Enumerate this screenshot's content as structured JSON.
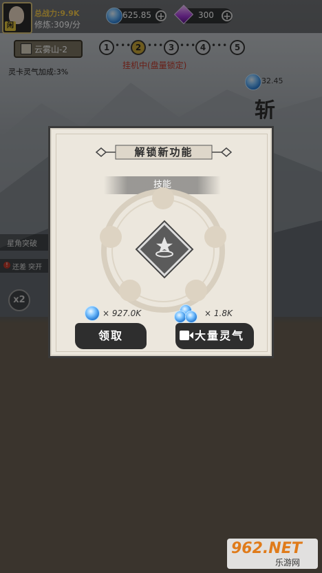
{
  "topbar": {
    "combat_label": "总战力:",
    "combat_value": "9.9K",
    "cultivation_label": "修炼:",
    "cultivation_value": "309/分",
    "spirit_amount": "625.85",
    "gem_amount": "300"
  },
  "stage": {
    "location": "云雾山-2",
    "steps": [
      "1",
      "2",
      "3",
      "4",
      "5"
    ],
    "active_step": 2,
    "status": "挂机中(盘量锁定)",
    "bonus_text": "灵卡灵气加成:3%",
    "right_value": "32.45",
    "right_banner": "斩"
  },
  "background_ui": {
    "side_label_1": "星角突破",
    "side_label_2": "还差 突开",
    "speed_button": "x2"
  },
  "dialog": {
    "title": "解锁新功能",
    "section": "技能",
    "reward_left": "× 927.0K",
    "reward_right": "× 1.8K",
    "claim_label": "领取",
    "video_label": "大量灵气"
  },
  "watermark": {
    "brand": "962.NET",
    "sub": "乐游网"
  },
  "colors": {
    "accent_gold": "#c9a63a",
    "ink": "#2e2e2e",
    "parchment": "#ece7dd"
  }
}
